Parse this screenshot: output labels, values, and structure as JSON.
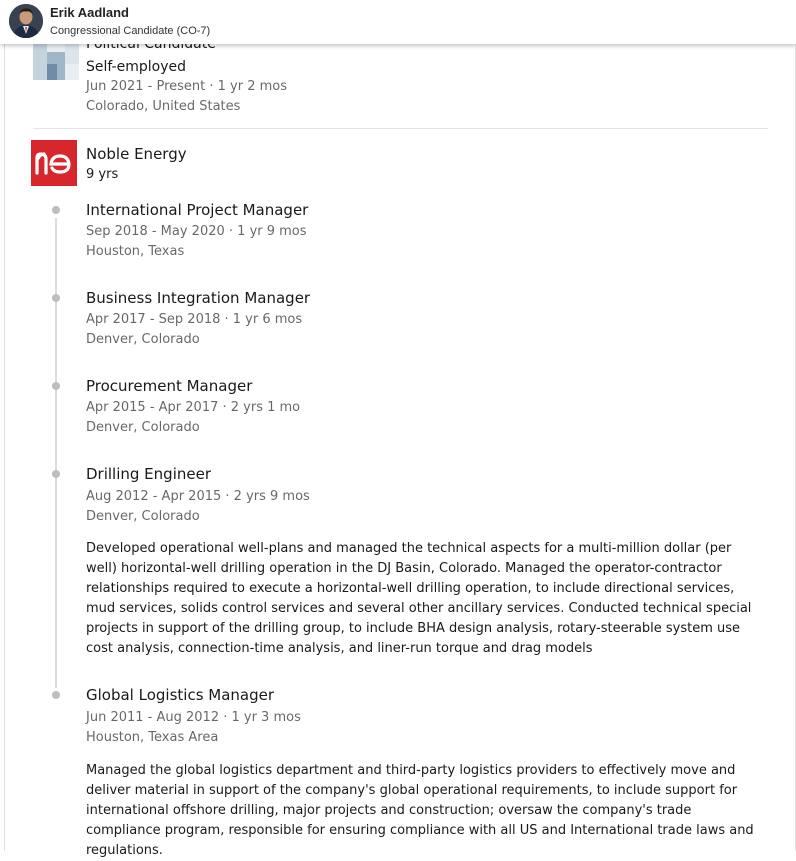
{
  "header": {
    "name": "Erik Aadland",
    "subtitle": "Congressional Candidate (CO-7)"
  },
  "first_position": {
    "title": "Political Candidate",
    "employment_type": "Self-employed",
    "dates": "Jun 2021 - Present · 1 yr 2 mos",
    "location": "Colorado, United States"
  },
  "company": {
    "name": "Noble Energy",
    "duration": "9 yrs",
    "logo_text": "ne",
    "brand_color": "#d7262c"
  },
  "roles": [
    {
      "title": "International Project Manager",
      "dates": "Sep 2018 - May 2020 · 1 yr 9 mos",
      "location": "Houston, Texas"
    },
    {
      "title": "Business Integration Manager",
      "dates": "Apr 2017 - Sep 2018 · 1 yr 6 mos",
      "location": "Denver, Colorado"
    },
    {
      "title": "Procurement Manager",
      "dates": "Apr 2015 - Apr 2017 · 2 yrs 1 mo",
      "location": "Denver, Colorado"
    },
    {
      "title": "Drilling Engineer",
      "dates": "Aug 2012 - Apr 2015 · 2 yrs 9 mos",
      "location": "Denver, Colorado",
      "description": "Developed operational well-plans and managed the technical aspects for a multi-million dollar (per well) horizontal-well drilling operation in the DJ Basin, Colorado. Managed the operator-contractor relationships required to execute a horizontal-well drilling operation, to include directional services, mud services, solids control services and several other ancillary services. Conducted technical special projects in support of the drilling group, to include BHA design analysis, rotary-steerable system use cost analysis, connection-time analysis, and liner-run torque and drag models"
    },
    {
      "title": "Global Logistics Manager",
      "dates": "Jun 2011 - Aug 2012 · 1 yr 3 mos",
      "location": "Houston, Texas Area",
      "description": "Managed the global logistics department and third-party logistics providers to effectively move and deliver material in support of the company's global operational requirements, to include support for international offshore drilling, major projects and construction; oversaw the company's trade compliance program, responsible for ensuring compliance with all US and International trade laws and regulations."
    }
  ]
}
